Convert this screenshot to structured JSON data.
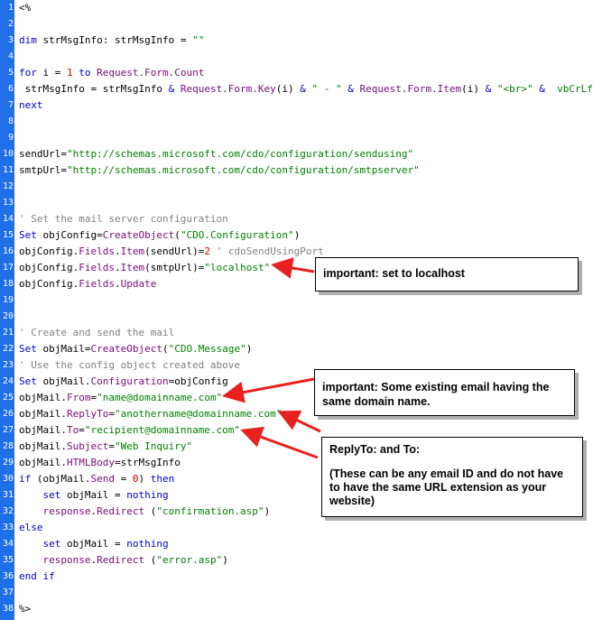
{
  "lines": [
    {
      "n": "1",
      "tokens": [
        {
          "t": "<%",
          "c": "plain"
        }
      ]
    },
    {
      "n": "2",
      "tokens": []
    },
    {
      "n": "3",
      "tokens": [
        {
          "t": "dim ",
          "c": "kw"
        },
        {
          "t": "strMsgInfo: strMsgInfo = ",
          "c": "plain"
        },
        {
          "t": "\"\"",
          "c": "str"
        }
      ]
    },
    {
      "n": "4",
      "tokens": []
    },
    {
      "n": "5",
      "tokens": [
        {
          "t": "for ",
          "c": "kw"
        },
        {
          "t": "i = ",
          "c": "plain"
        },
        {
          "t": "1",
          "c": "num"
        },
        {
          "t": " to ",
          "c": "kw"
        },
        {
          "t": "Request.Form.Count",
          "c": "obj"
        }
      ]
    },
    {
      "n": "6",
      "tokens": [
        {
          "t": " strMsgInfo = strMsgInfo ",
          "c": "plain"
        },
        {
          "t": "& ",
          "c": "kw"
        },
        {
          "t": "Request.Form.Key",
          "c": "obj"
        },
        {
          "t": "(i) ",
          "c": "plain"
        },
        {
          "t": "& ",
          "c": "kw"
        },
        {
          "t": "\" - \"",
          "c": "str"
        },
        {
          "t": " & ",
          "c": "kw"
        },
        {
          "t": "Request.Form.Item",
          "c": "obj"
        },
        {
          "t": "(i) ",
          "c": "plain"
        },
        {
          "t": "& ",
          "c": "kw"
        },
        {
          "t": "\"<br>\"",
          "c": "str"
        },
        {
          "t": " &  ",
          "c": "kw"
        },
        {
          "t": "vbCrLf",
          "c": "str"
        }
      ]
    },
    {
      "n": "7",
      "tokens": [
        {
          "t": "next",
          "c": "kw"
        }
      ]
    },
    {
      "n": "8",
      "tokens": []
    },
    {
      "n": "9",
      "tokens": []
    },
    {
      "n": "10",
      "tokens": [
        {
          "t": "sendUrl=",
          "c": "plain"
        },
        {
          "t": "\"http://schemas.microsoft.com/cdo/configuration/sendusing\"",
          "c": "str"
        }
      ]
    },
    {
      "n": "11",
      "tokens": [
        {
          "t": "smtpUrl=",
          "c": "plain"
        },
        {
          "t": "\"http://schemas.microsoft.com/cdo/configuration/smtpserver\"",
          "c": "str"
        }
      ]
    },
    {
      "n": "12",
      "tokens": []
    },
    {
      "n": "13",
      "tokens": []
    },
    {
      "n": "14",
      "tokens": [
        {
          "t": "' Set the mail server configuration",
          "c": "cmt"
        }
      ]
    },
    {
      "n": "15",
      "tokens": [
        {
          "t": "Set ",
          "c": "kw"
        },
        {
          "t": "objConfig=",
          "c": "plain"
        },
        {
          "t": "CreateObject",
          "c": "obj"
        },
        {
          "t": "(",
          "c": "plain"
        },
        {
          "t": "\"CDO.Configuration\"",
          "c": "str"
        },
        {
          "t": ")",
          "c": "plain"
        }
      ]
    },
    {
      "n": "16",
      "tokens": [
        {
          "t": "objConfig.",
          "c": "plain"
        },
        {
          "t": "Fields",
          "c": "obj"
        },
        {
          "t": ".",
          "c": "plain"
        },
        {
          "t": "Item",
          "c": "obj"
        },
        {
          "t": "(sendUrl)=",
          "c": "plain"
        },
        {
          "t": "2",
          "c": "num"
        },
        {
          "t": " ' cdoSendUsingPort",
          "c": "cmt"
        }
      ]
    },
    {
      "n": "17",
      "tokens": [
        {
          "t": "objConfig.",
          "c": "plain"
        },
        {
          "t": "Fields",
          "c": "obj"
        },
        {
          "t": ".",
          "c": "plain"
        },
        {
          "t": "Item",
          "c": "obj"
        },
        {
          "t": "(smtpUrl)=",
          "c": "plain"
        },
        {
          "t": "\"localhost\"",
          "c": "str"
        }
      ]
    },
    {
      "n": "18",
      "tokens": [
        {
          "t": "objConfig.",
          "c": "plain"
        },
        {
          "t": "Fields",
          "c": "obj"
        },
        {
          "t": ".",
          "c": "plain"
        },
        {
          "t": "Update",
          "c": "obj"
        }
      ]
    },
    {
      "n": "19",
      "tokens": []
    },
    {
      "n": "20",
      "tokens": []
    },
    {
      "n": "21",
      "tokens": [
        {
          "t": "' Create and send the mail",
          "c": "cmt"
        }
      ]
    },
    {
      "n": "22",
      "tokens": [
        {
          "t": "Set ",
          "c": "kw"
        },
        {
          "t": "objMail=",
          "c": "plain"
        },
        {
          "t": "CreateObject",
          "c": "obj"
        },
        {
          "t": "(",
          "c": "plain"
        },
        {
          "t": "\"CDO.Message\"",
          "c": "str"
        },
        {
          "t": ")",
          "c": "plain"
        }
      ]
    },
    {
      "n": "23",
      "tokens": [
        {
          "t": "' Use the config object created above",
          "c": "cmt"
        }
      ]
    },
    {
      "n": "24",
      "tokens": [
        {
          "t": "Set ",
          "c": "kw"
        },
        {
          "t": "objMail.",
          "c": "plain"
        },
        {
          "t": "Configuration",
          "c": "obj"
        },
        {
          "t": "=objConfig",
          "c": "plain"
        }
      ]
    },
    {
      "n": "25",
      "tokens": [
        {
          "t": "objMail.",
          "c": "plain"
        },
        {
          "t": "From",
          "c": "obj"
        },
        {
          "t": "=",
          "c": "plain"
        },
        {
          "t": "\"name@domainname.com\"",
          "c": "str"
        }
      ]
    },
    {
      "n": "26",
      "tokens": [
        {
          "t": "objMail.",
          "c": "plain"
        },
        {
          "t": "ReplyTo",
          "c": "obj"
        },
        {
          "t": "=",
          "c": "plain"
        },
        {
          "t": "\"anothername@domainname.com\"",
          "c": "str"
        }
      ]
    },
    {
      "n": "27",
      "tokens": [
        {
          "t": "objMail.",
          "c": "plain"
        },
        {
          "t": "To",
          "c": "obj"
        },
        {
          "t": "=",
          "c": "plain"
        },
        {
          "t": "\"recipient@domainname.com\"",
          "c": "str"
        }
      ]
    },
    {
      "n": "28",
      "tokens": [
        {
          "t": "objMail.",
          "c": "plain"
        },
        {
          "t": "Subject",
          "c": "obj"
        },
        {
          "t": "=",
          "c": "plain"
        },
        {
          "t": "\"Web Inquiry\"",
          "c": "str"
        }
      ]
    },
    {
      "n": "29",
      "tokens": [
        {
          "t": "objMail.",
          "c": "plain"
        },
        {
          "t": "HTMLBody",
          "c": "obj"
        },
        {
          "t": "=strMsgInfo",
          "c": "plain"
        }
      ]
    },
    {
      "n": "30",
      "tokens": [
        {
          "t": "if ",
          "c": "kw"
        },
        {
          "t": "(objMail.",
          "c": "plain"
        },
        {
          "t": "Send",
          "c": "obj"
        },
        {
          "t": " = ",
          "c": "plain"
        },
        {
          "t": "0",
          "c": "num"
        },
        {
          "t": ") ",
          "c": "plain"
        },
        {
          "t": "then",
          "c": "kw"
        }
      ]
    },
    {
      "n": "31",
      "tokens": [
        {
          "t": "    ",
          "c": "plain"
        },
        {
          "t": "set ",
          "c": "kw"
        },
        {
          "t": "objMail = ",
          "c": "plain"
        },
        {
          "t": "nothing",
          "c": "kw"
        }
      ]
    },
    {
      "n": "32",
      "tokens": [
        {
          "t": "    ",
          "c": "plain"
        },
        {
          "t": "response",
          "c": "obj"
        },
        {
          "t": ".",
          "c": "plain"
        },
        {
          "t": "Redirect",
          "c": "obj"
        },
        {
          "t": " (",
          "c": "plain"
        },
        {
          "t": "\"confirmation.asp\"",
          "c": "str"
        },
        {
          "t": ")",
          "c": "plain"
        }
      ]
    },
    {
      "n": "33",
      "tokens": [
        {
          "t": "else",
          "c": "kw"
        }
      ]
    },
    {
      "n": "34",
      "tokens": [
        {
          "t": "    ",
          "c": "plain"
        },
        {
          "t": "set ",
          "c": "kw"
        },
        {
          "t": "objMail = ",
          "c": "plain"
        },
        {
          "t": "nothing",
          "c": "kw"
        }
      ]
    },
    {
      "n": "35",
      "tokens": [
        {
          "t": "    ",
          "c": "plain"
        },
        {
          "t": "response",
          "c": "obj"
        },
        {
          "t": ".",
          "c": "plain"
        },
        {
          "t": "Redirect",
          "c": "obj"
        },
        {
          "t": " (",
          "c": "plain"
        },
        {
          "t": "\"error.asp\"",
          "c": "str"
        },
        {
          "t": ")",
          "c": "plain"
        }
      ]
    },
    {
      "n": "36",
      "tokens": [
        {
          "t": "end if",
          "c": "kw"
        }
      ]
    },
    {
      "n": "37",
      "tokens": []
    },
    {
      "n": "38",
      "tokens": [
        {
          "t": "%>",
          "c": "plain"
        }
      ]
    }
  ],
  "callouts": {
    "localhost": "important: set to localhost",
    "from": "important: Some existing email having the same domain name.",
    "replyto_title": "ReplyTo: and To:",
    "replyto_body": "(These can be any email ID and do not have to have the same URL extension as your website)"
  },
  "colors": {
    "gutter": "#1f6fe8",
    "arrow": "#e8201e",
    "keyword": "#0000cc",
    "object": "#7a0a7a",
    "string": "#008000",
    "number": "#cc0000",
    "comment": "#808080"
  }
}
